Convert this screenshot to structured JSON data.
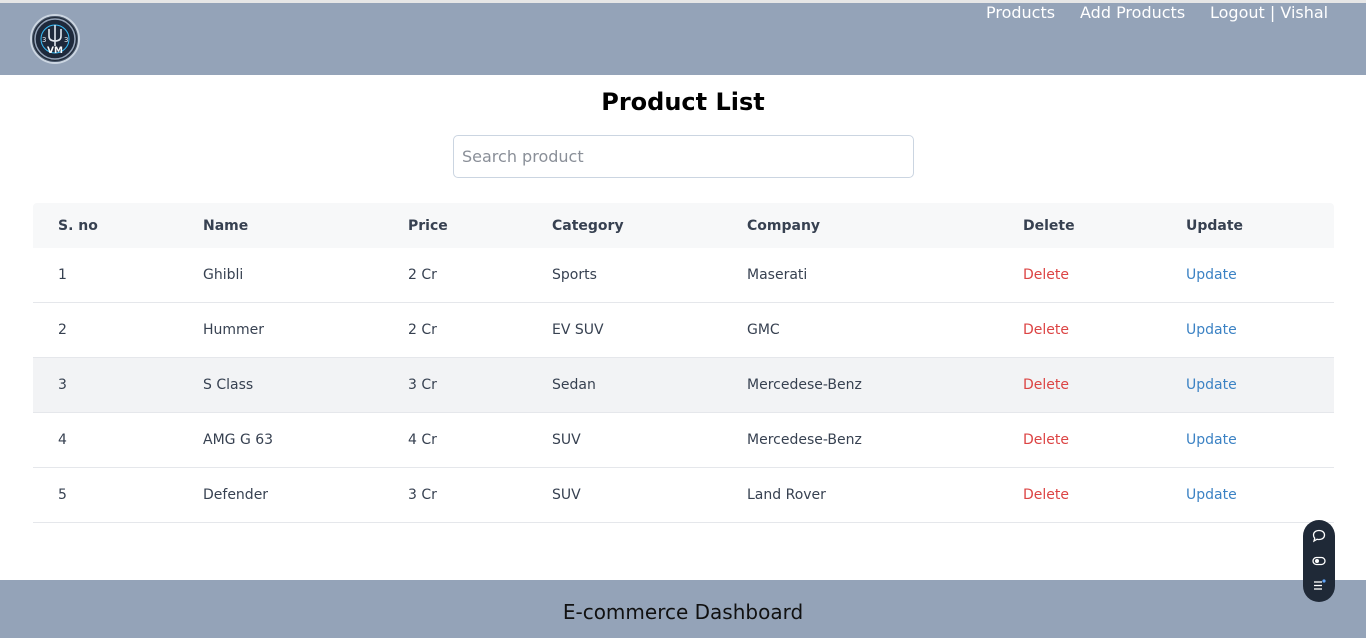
{
  "nav": {
    "logo_alt": "VM logo",
    "links": [
      "Products",
      "Add Products",
      "Logout | Vishal"
    ]
  },
  "main": {
    "title": "Product List",
    "search_placeholder": "Search product"
  },
  "table": {
    "headers": [
      "S. no",
      "Name",
      "Price",
      "Category",
      "Company",
      "Delete",
      "Update"
    ],
    "rows": [
      {
        "sno": "1",
        "name": "Ghibli",
        "price": "2 Cr",
        "category": "Sports",
        "company": "Maserati",
        "delete": "Delete",
        "update": "Update"
      },
      {
        "sno": "2",
        "name": "Hummer",
        "price": "2 Cr",
        "category": "EV SUV",
        "company": "GMC",
        "delete": "Delete",
        "update": "Update"
      },
      {
        "sno": "3",
        "name": "S Class",
        "price": "3 Cr",
        "category": "Sedan",
        "company": "Mercedese-Benz",
        "delete": "Delete",
        "update": "Update"
      },
      {
        "sno": "4",
        "name": "AMG G 63",
        "price": "4 Cr",
        "category": "SUV",
        "company": "Mercedese-Benz",
        "delete": "Delete",
        "update": "Update"
      },
      {
        "sno": "5",
        "name": "Defender",
        "price": "3 Cr",
        "category": "SUV",
        "company": "Land Rover",
        "delete": "Delete",
        "update": "Update"
      }
    ]
  },
  "footer": {
    "text": "E-commerce Dashboard"
  },
  "colors": {
    "navbar": "#94a3b8",
    "delete": "#dc4444",
    "update": "#3b82c4"
  },
  "icons": {
    "widget": [
      "chat-bubble-icon",
      "toggle-icon",
      "list-icon"
    ]
  }
}
